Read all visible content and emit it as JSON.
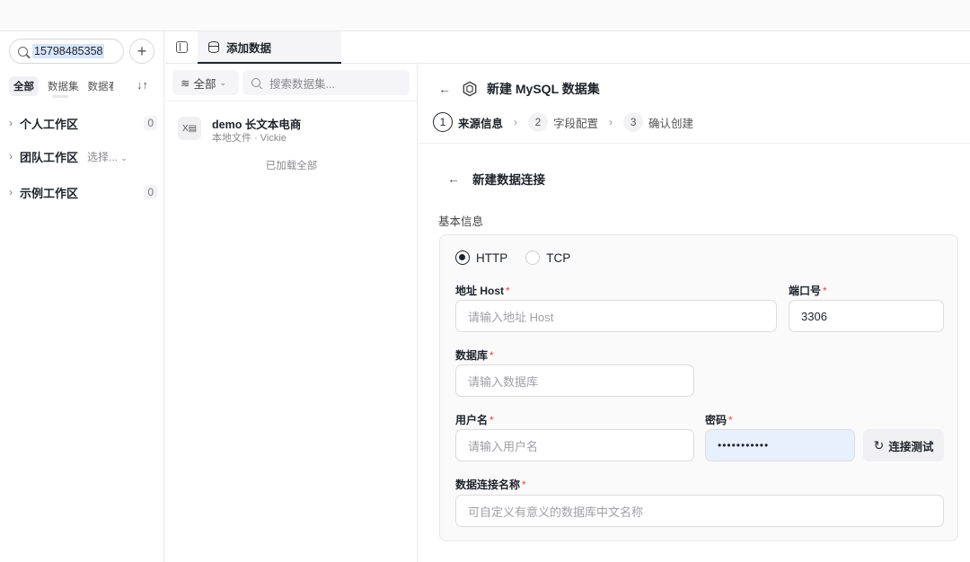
{
  "sidebar": {
    "search_value": "15798485358",
    "filters": [
      "全部",
      "数据集",
      "数据看板"
    ],
    "workspaces": [
      {
        "label": "个人工作区",
        "count": "0"
      },
      {
        "label": "团队工作区",
        "select": "选择..."
      },
      {
        "label": "示例工作区",
        "count": "0"
      }
    ]
  },
  "tabbar": {
    "tab_label": "添加数据"
  },
  "dataset_panel": {
    "filter_label": "全部",
    "search_placeholder": "搜索数据集...",
    "item": {
      "title": "demo 长文本电商",
      "subtitle": "本地文件 · Vickie"
    },
    "loaded_text": "已加载全部"
  },
  "form": {
    "title": "新建 MySQL 数据集",
    "steps": [
      {
        "num": "1",
        "label": "来源信息"
      },
      {
        "num": "2",
        "label": "字段配置"
      },
      {
        "num": "3",
        "label": "确认创建"
      }
    ],
    "conn_title": "新建数据连接",
    "section_label": "基本信息",
    "protocols": [
      "HTTP",
      "TCP"
    ],
    "host_label": "地址 Host",
    "host_placeholder": "请输入地址 Host",
    "port_label": "端口号",
    "port_value": "3306",
    "db_label": "数据库",
    "db_placeholder": "请输入数据库",
    "user_label": "用户名",
    "user_placeholder": "请输入用户名",
    "pw_label": "密码",
    "pw_value": "•••••••••••",
    "test_button": "连接测试",
    "name_label": "数据连接名称",
    "name_placeholder": "可自定义有意义的数据库中文名称",
    "required_mark": "*"
  }
}
